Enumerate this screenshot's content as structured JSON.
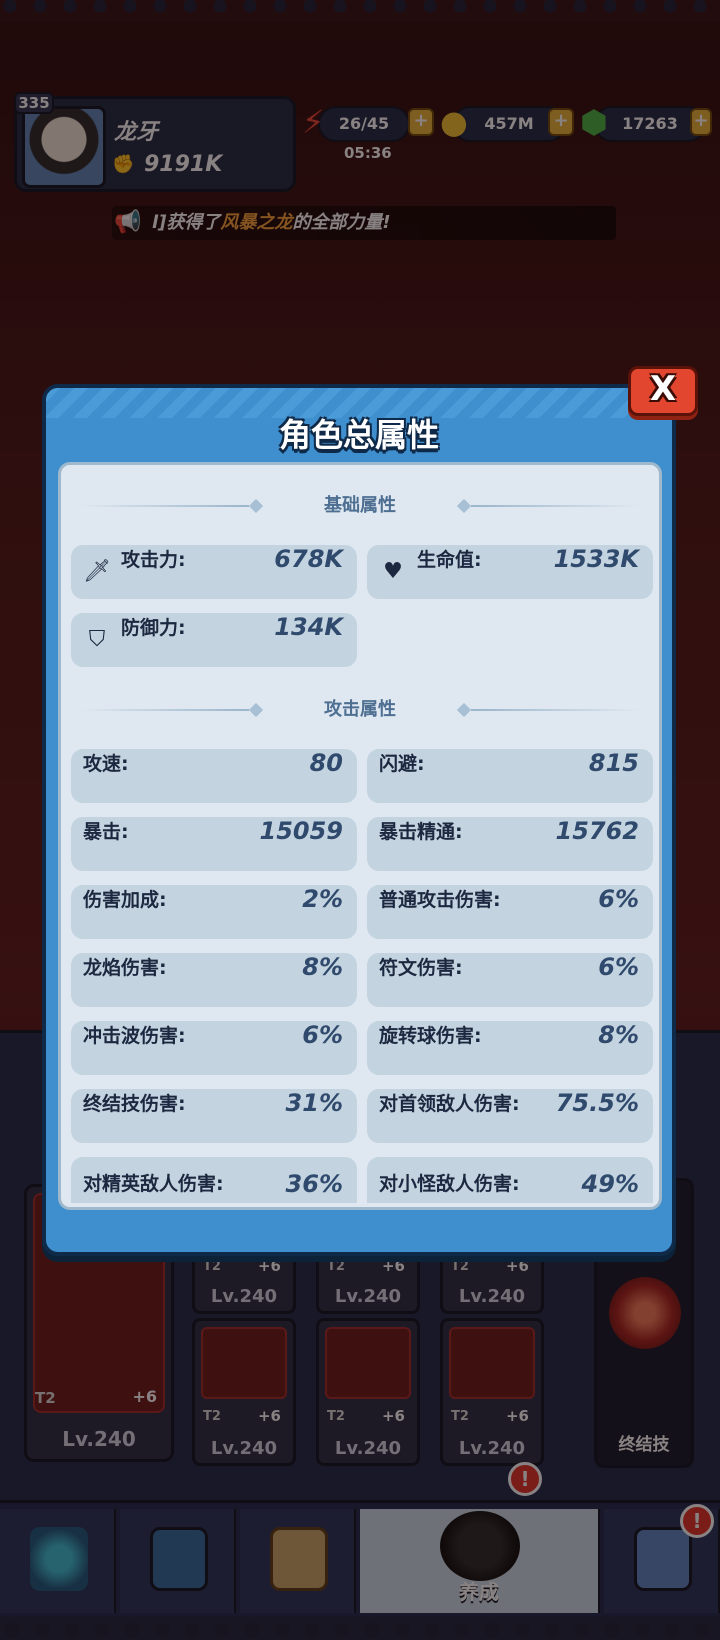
{
  "header": {
    "level": "335",
    "player_name": "龙牙",
    "power": "9191K",
    "energy": "26/45",
    "timer": "05:36",
    "gold": "457M",
    "gems": "17263",
    "plus": "+"
  },
  "broadcast": {
    "prefix": "l]获得了",
    "highlight": "风暴之龙",
    "suffix": "的全部力量!"
  },
  "modal": {
    "title": "角色总属性",
    "close_label": "X",
    "sections": {
      "basic": "基础属性",
      "attack": "攻击属性"
    },
    "basic_stats": [
      {
        "label": "攻击力:",
        "value": "678K",
        "icon": "sword-icon"
      },
      {
        "label": "生命值:",
        "value": "1533K",
        "icon": "heart-icon"
      },
      {
        "label": "防御力:",
        "value": "134K",
        "icon": "shield-icon"
      }
    ],
    "attack_stats": [
      {
        "label": "攻速:",
        "value": "80"
      },
      {
        "label": "闪避:",
        "value": "815"
      },
      {
        "label": "暴击:",
        "value": "15059"
      },
      {
        "label": "暴击精通:",
        "value": "15762"
      },
      {
        "label": "伤害加成:",
        "value": "2%"
      },
      {
        "label": "普通攻击伤害:",
        "value": "6%"
      },
      {
        "label": "龙焰伤害:",
        "value": "8%"
      },
      {
        "label": "符文伤害:",
        "value": "6%"
      },
      {
        "label": "冲击波伤害:",
        "value": "6%"
      },
      {
        "label": "旋转球伤害:",
        "value": "8%"
      },
      {
        "label": "终结技伤害:",
        "value": "31%"
      },
      {
        "label": "对首领敌人伤害:",
        "value": "75.5%"
      },
      {
        "label": "对精英敌人伤害:",
        "value": "36%"
      },
      {
        "label": "对小怪敌人伤害:",
        "value": "49%"
      }
    ]
  },
  "equipment": {
    "tier": "T2",
    "plus": "+6",
    "level": "Lv.240"
  },
  "skill": {
    "label": "终结技"
  },
  "nav": {
    "active_label": "养成",
    "badge": "!"
  },
  "colors": {
    "modal_blue": "#3f8fcf",
    "panel_bg": "#dfe8f0",
    "stat_bg": "#c4d3e0",
    "close_red": "#e2462e",
    "highlight_orange": "#f6a23a"
  }
}
